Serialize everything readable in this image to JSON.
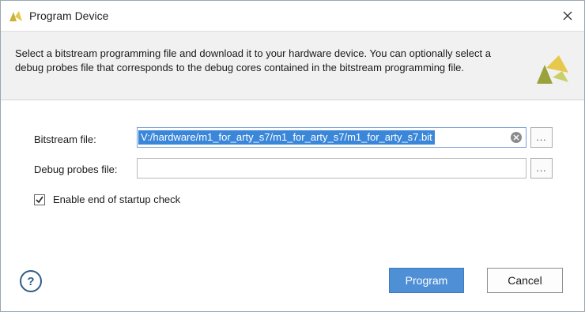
{
  "window": {
    "title": "Program Device",
    "close_icon": "close-icon",
    "title_icon": "xilinx-vivado-icon"
  },
  "description": {
    "text": "Select a bitstream programming file and download it to your hardware device. You can optionally select a debug probes file that corresponds to the debug cores contained in the bitstream programming file.",
    "logo_icon": "xilinx-logo-icon"
  },
  "form": {
    "bitstream": {
      "label": "Bitstream file:",
      "value": "V:/hardware/m1_for_arty_s7/m1_for_arty_s7/m1_for_arty_s7.bit",
      "browse_label": "..."
    },
    "debug_probes": {
      "label": "Debug probes file:",
      "value": "",
      "browse_label": "..."
    },
    "startup_check": {
      "label": "Enable end of startup check",
      "checked": true
    }
  },
  "footer": {
    "help_label": "?",
    "program_label": "Program",
    "cancel_label": "Cancel"
  },
  "colors": {
    "accent": "#4f8fd6",
    "selection": "#3a86d8",
    "logo_yellow": "#e6c84a",
    "logo_olive": "#9aa23c"
  }
}
